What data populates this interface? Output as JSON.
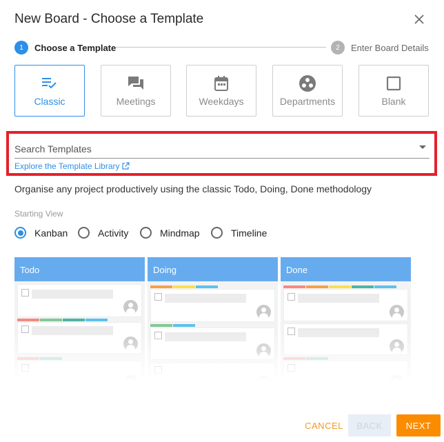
{
  "dialog": {
    "title": "New Board - Choose a Template"
  },
  "stepper": {
    "steps": [
      {
        "number": "1",
        "label": "Choose a Template",
        "active": true
      },
      {
        "number": "2",
        "label": "Enter Board Details",
        "active": false
      }
    ]
  },
  "templates": [
    {
      "label": "Classic",
      "icon": "checklist-icon",
      "selected": true
    },
    {
      "label": "Meetings",
      "icon": "chat-icon",
      "selected": false
    },
    {
      "label": "Weekdays",
      "icon": "calendar-icon",
      "selected": false
    },
    {
      "label": "Departments",
      "icon": "group-icon",
      "selected": false
    },
    {
      "label": "Blank",
      "icon": "blank-square-icon",
      "selected": false
    }
  ],
  "search": {
    "placeholder": "Search Templates",
    "value": ""
  },
  "library_link": "Explore the Template Library",
  "description": "Organise any project productively using the classic Todo, Doing, Done methodology",
  "starting_view": {
    "label": "Starting View",
    "options": [
      "Kanban",
      "Activity",
      "Mindmap",
      "Timeline"
    ],
    "selected": "Kanban"
  },
  "preview": {
    "columns": [
      "Todo",
      "Doing",
      "Done"
    ],
    "label_colors": {
      "red": "#f28b82",
      "orange": "#f6a04d",
      "yellow": "#f9e04a",
      "green": "#81c995",
      "teal": "#4fb3a4",
      "blue": "#5cc1ee",
      "pink": "#f7b9b9",
      "mint": "#a8dcd8"
    }
  },
  "footer": {
    "cancel": "CANCEL",
    "back": "BACK",
    "next": "NEXT"
  },
  "colors": {
    "accent": "#2d8fe6",
    "primary_action": "#fb8c00",
    "highlight": "#e4212b"
  }
}
